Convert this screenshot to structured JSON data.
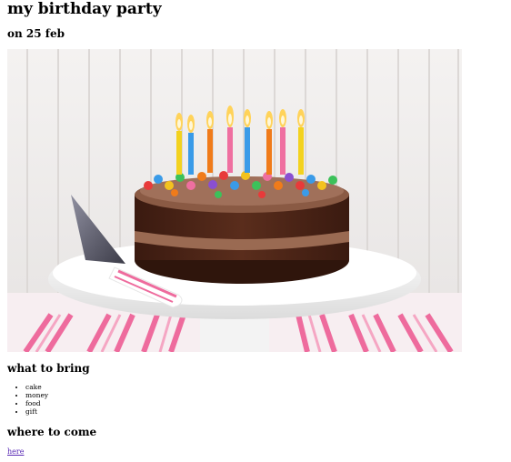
{
  "page": {
    "title": "my birthday party",
    "date": "on 25 feb"
  },
  "image": {
    "alt": "birthday cake with candles",
    "icon": "birthday-cake-photo"
  },
  "bring": {
    "heading": "what to bring",
    "items": [
      "cake",
      "money",
      "food",
      "gift"
    ]
  },
  "where": {
    "heading": "where to come",
    "link_text": "here"
  },
  "colors": {
    "link": "#5a2bb5",
    "stripe_pink": "#ef6fa0",
    "cake_brown": "#4a2416",
    "frosting": "#8a5a44"
  }
}
